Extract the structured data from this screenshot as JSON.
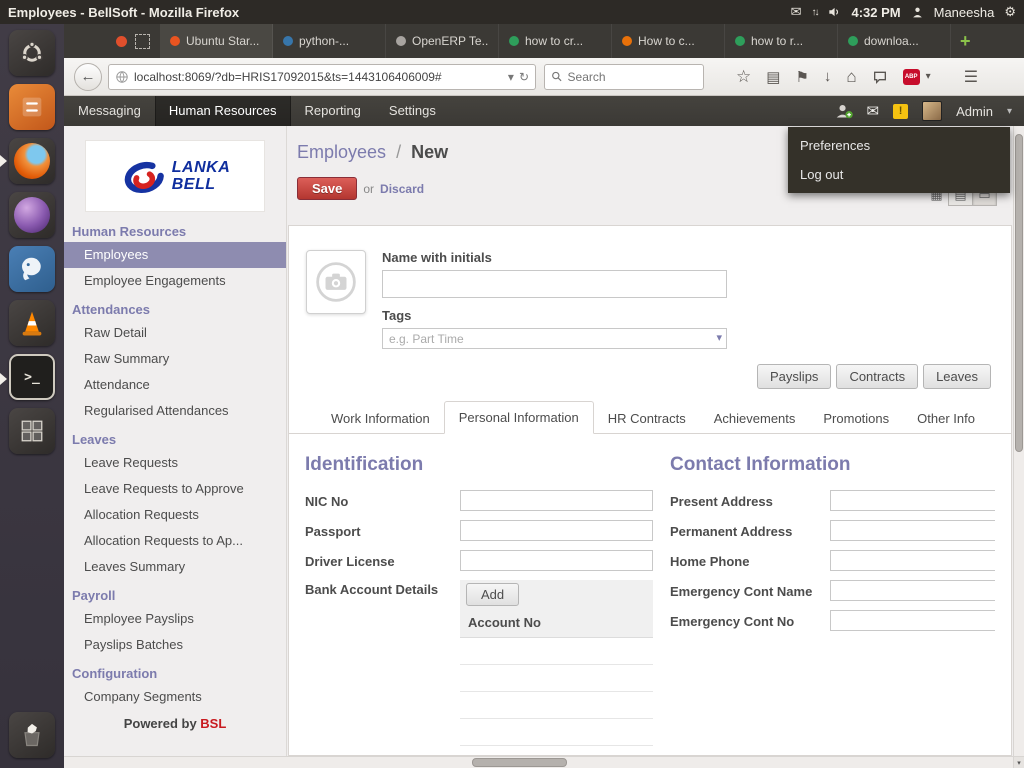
{
  "colors": {
    "accent_purple": "#7c7bad",
    "save_red": "#b33630",
    "brand_red": "#c81a1f",
    "warning_yellow": "#f5c211",
    "sidebar_active": "#8e8cb0",
    "menubar_bg": "#3e3c38"
  },
  "icons": {
    "envelope": "✉",
    "gear": "⚙",
    "network_arrows": "↑↓",
    "caret_down": "▾",
    "back_arrow": "←",
    "reload": "↻",
    "star": "☆",
    "reading_list": "▤",
    "flag": "⚑",
    "download_arrow": "↓",
    "home": "⌂",
    "hamburger": "☰",
    "plus": "+",
    "abp": "ABP",
    "warning_mark": "!",
    "terminal_prompt": ">_",
    "grid_view": "▦",
    "list_view": "▤",
    "form_view": "▭"
  },
  "titlebar": {
    "title": "Employees - BellSoft - Mozilla Firefox",
    "time": "4:32 PM",
    "user": "Maneesha"
  },
  "browser": {
    "tabs": [
      {
        "label": "Ubuntu Star..."
      },
      {
        "label": "python-..."
      },
      {
        "label": "OpenERP Te..."
      },
      {
        "label": "how to cr..."
      },
      {
        "label": "How to c..."
      },
      {
        "label": "how to r..."
      },
      {
        "label": "downloa..."
      }
    ],
    "url": "localhost:8069/?db=HRIS17092015&ts=1443106406009#",
    "search_placeholder": "Search"
  },
  "menubar": {
    "items": [
      {
        "label": "Messaging"
      },
      {
        "label": "Human Resources"
      },
      {
        "label": "Reporting"
      },
      {
        "label": "Settings"
      }
    ],
    "user": "Admin",
    "dropdown": [
      {
        "label": "Preferences"
      },
      {
        "label": "Log out"
      }
    ]
  },
  "sidebar": {
    "logo": {
      "line1": "LANKA",
      "line2": "BELL"
    },
    "sections": [
      {
        "title": "Human Resources",
        "items": [
          {
            "label": "Employees"
          },
          {
            "label": "Employee Engagements"
          }
        ]
      },
      {
        "title": "Attendances",
        "items": [
          {
            "label": "Raw Detail"
          },
          {
            "label": "Raw Summary"
          },
          {
            "label": "Attendance"
          },
          {
            "label": "Regularised Attendances"
          }
        ]
      },
      {
        "title": "Leaves",
        "items": [
          {
            "label": "Leave Requests"
          },
          {
            "label": "Leave Requests to Approve"
          },
          {
            "label": "Allocation Requests"
          },
          {
            "label": "Allocation Requests to Ap..."
          },
          {
            "label": "Leaves Summary"
          }
        ]
      },
      {
        "title": "Payroll",
        "items": [
          {
            "label": "Employee Payslips"
          },
          {
            "label": "Payslips Batches"
          }
        ]
      },
      {
        "title": "Configuration",
        "items": [
          {
            "label": "Company Segments"
          }
        ]
      }
    ],
    "footer": {
      "text": "Powered by",
      "brand": "BSL"
    }
  },
  "content": {
    "breadcrumb": {
      "parent": "Employees",
      "separator": "/",
      "current": "New"
    },
    "save": "Save",
    "or": "or",
    "discard": "Discard",
    "form": {
      "name_label": "Name with initials",
      "tags_label": "Tags",
      "tags_placeholder": "e.g. Part Time",
      "buttons": [
        {
          "label": "Payslips"
        },
        {
          "label": "Contracts"
        },
        {
          "label": "Leaves"
        }
      ],
      "tabs": [
        {
          "label": "Work Information"
        },
        {
          "label": "Personal Information"
        },
        {
          "label": "HR Contracts"
        },
        {
          "label": "Achievements"
        },
        {
          "label": "Promotions"
        },
        {
          "label": "Other Info"
        }
      ],
      "identification": {
        "title": "Identification",
        "fields": [
          {
            "label": "NIC No"
          },
          {
            "label": "Passport"
          },
          {
            "label": "Driver License"
          },
          {
            "label": "Bank Account Details"
          }
        ],
        "add_button": "Add",
        "column_header": "Account No"
      },
      "contact": {
        "title": "Contact Information",
        "fields": [
          {
            "label": "Present Address"
          },
          {
            "label": "Permanent Address"
          },
          {
            "label": "Home Phone"
          },
          {
            "label": "Emergency Cont Name"
          },
          {
            "label": "Emergency Cont No"
          }
        ]
      }
    }
  }
}
